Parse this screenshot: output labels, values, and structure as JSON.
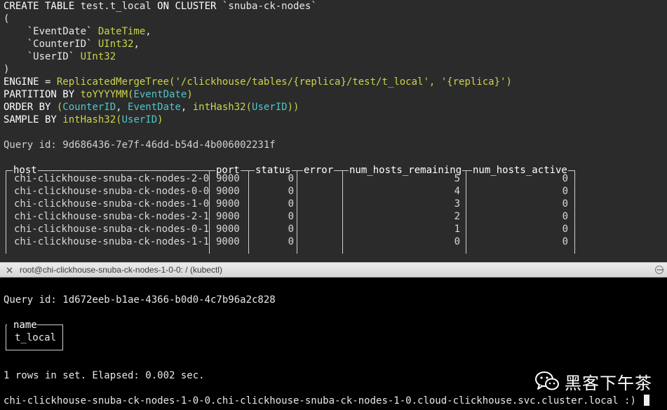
{
  "top_terminal": {
    "sql": {
      "create_kw": "CREATE TABLE",
      "table_name": " test.t_local ",
      "on_cluster_kw": "ON CLUSTER",
      "cluster_name": " `snuba-ck-nodes`",
      "open_paren": "(",
      "col1_name": "    `EventDate` ",
      "col1_type": "DateTime",
      "col1_sep": ",",
      "col2_name": "    `CounterID` ",
      "col2_type": "UInt32",
      "col2_sep": ",",
      "col3_name": "    `UserID` ",
      "col3_type": "UInt32",
      "close_paren": ")",
      "engine_kw": "ENGINE",
      "engine_eq": " = ",
      "engine_fn": "ReplicatedMergeTree",
      "engine_args": "('/clickhouse/tables/{replica}/test/t_local', '{replica}')",
      "partition_kw": "PARTITION BY",
      "partition_fn": " toYYYYMM",
      "partition_open": "(",
      "partition_col": "EventDate",
      "partition_close": ")",
      "order_kw": "ORDER BY",
      "order_open": " (",
      "order_col1": "CounterID",
      "order_sep1": ", ",
      "order_col2": "EventDate",
      "order_sep2": ", ",
      "order_fn": "intHash32",
      "order_fn_open": "(",
      "order_col3": "UserID",
      "order_close": "))",
      "sample_kw": "SAMPLE BY",
      "sample_fn": " intHash32",
      "sample_open": "(",
      "sample_col": "UserID",
      "sample_close": ")"
    },
    "query_id_line": "Query id: 9d686436-7e7f-46dd-b54d-4b006002231f",
    "table": {
      "headers": [
        "host",
        "port",
        "status",
        "error",
        "num_hosts_remaining",
        "num_hosts_active"
      ],
      "rows": [
        [
          "chi-clickhouse-snuba-ck-nodes-2-0",
          "9000",
          "0",
          "",
          "5",
          "0"
        ],
        [
          "chi-clickhouse-snuba-ck-nodes-0-0",
          "9000",
          "0",
          "",
          "4",
          "0"
        ],
        [
          "chi-clickhouse-snuba-ck-nodes-1-0",
          "9000",
          "0",
          "",
          "3",
          "0"
        ],
        [
          "chi-clickhouse-snuba-ck-nodes-2-1",
          "9000",
          "0",
          "",
          "2",
          "0"
        ],
        [
          "chi-clickhouse-snuba-ck-nodes-0-1",
          "9000",
          "0",
          "",
          "1",
          "0"
        ],
        [
          "chi-clickhouse-snuba-ck-nodes-1-1",
          "9000",
          "0",
          "",
          "0",
          "0"
        ]
      ]
    }
  },
  "window": {
    "title": "root@chi-clickhouse-snuba-ck-nodes-1-0-0: / (kubectl)"
  },
  "bottom_terminal": {
    "query_id_line": "Query id: 1d672eeb-b1ae-4366-b0d0-4c7b96a2c828",
    "result_header": "name",
    "result_value": "t_local",
    "rows_line": "1 rows in set. Elapsed: 0.002 sec.",
    "prompt": "chi-clickhouse-snuba-ck-nodes-1-0-0.chi-clickhouse-snuba-ck-nodes-1-0.cloud-clickhouse.svc.cluster.local :) "
  },
  "watermark": {
    "text": "黑客下午茶",
    "icon": "wechat-icon"
  },
  "colors": {
    "top_bg": "#2b2b2b",
    "bottom_bg": "#000000",
    "keyword": "#ffffff",
    "function": "#cbd44c",
    "column": "#4fc5c8"
  }
}
